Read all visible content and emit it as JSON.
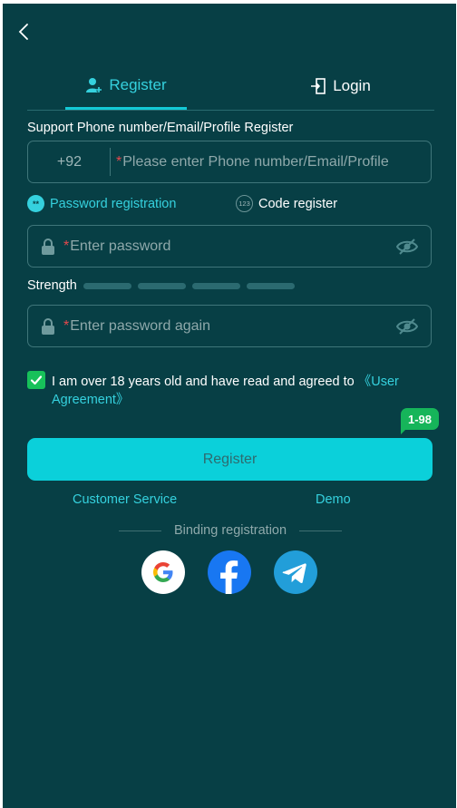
{
  "header": {
    "back_icon": "chevron-left-icon"
  },
  "tabs": [
    {
      "label": "Register",
      "icon": "user-add-icon",
      "active": true
    },
    {
      "label": "Login",
      "icon": "login-door-icon",
      "active": false
    }
  ],
  "form": {
    "support_label": "Support Phone number/Email/Profile Register",
    "country_code": "+92",
    "account_placeholder": "Please enter Phone number/Email/Profile",
    "required_mark": "*",
    "mode_password": "Password registration",
    "mode_code": "Code register",
    "mode_password_icon_text": "**",
    "mode_code_icon_text": "123",
    "password_placeholder": "Enter password",
    "strength_label": "Strength",
    "strength_level": 0,
    "password_again_placeholder": "Enter password again",
    "agree_checked": true,
    "agree_text": "I am over 18 years old and have read and agreed to ",
    "agree_link": "《User Agreement》",
    "submit_label": "Register"
  },
  "badge": {
    "text": "1-98"
  },
  "footer": {
    "customer_service": "Customer Service",
    "demo": "Demo",
    "binding_label": "Binding registration",
    "social": [
      "google-icon",
      "facebook-icon",
      "telegram-icon"
    ]
  },
  "colors": {
    "background": "#073f45",
    "accent": "#35d1de",
    "button": "#0bd0da",
    "checkbox": "#17c15a",
    "required": "#e5484d"
  }
}
